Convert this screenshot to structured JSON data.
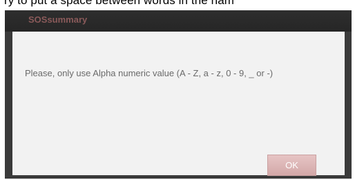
{
  "background": {
    "partial_text": "ry to put a space between words in the nam"
  },
  "dialog": {
    "title": "SOSsummary",
    "message": "Please, only use Alpha numeric value (A - Z, a - z, 0 - 9, _ or -)",
    "ok_label": "OK"
  },
  "colors": {
    "frame": "#3a3a3a",
    "title_text": "#8a5a5a",
    "content_bg": "#f2f2f2",
    "message_text": "#6a6a6a",
    "ok_button_bg": "#dbb3b3"
  }
}
